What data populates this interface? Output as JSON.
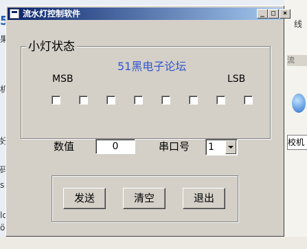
{
  "window": {
    "title": "流水灯控制软件",
    "minimize_glyph": "_",
    "maximize_glyph": "□",
    "close_glyph": "×"
  },
  "background": {
    "logo_fragment": "5",
    "right_fragment_top": "线",
    "right_bar_text": "流",
    "right_field_text": "校机",
    "left_fragments": [
      "果",
      "机",
      "好",
      "码",
      "s",
      "ld",
      "ö"
    ]
  },
  "led_group": {
    "legend": "小灯状态",
    "brand": "51黑电子论坛",
    "msb_label": "MSB",
    "lsb_label": "LSB",
    "leds": [
      {
        "bit": 7,
        "checked": false
      },
      {
        "bit": 6,
        "checked": false
      },
      {
        "bit": 5,
        "checked": false
      },
      {
        "bit": 4,
        "checked": false
      },
      {
        "bit": 3,
        "checked": false
      },
      {
        "bit": 2,
        "checked": false
      },
      {
        "bit": 1,
        "checked": false
      },
      {
        "bit": 0,
        "checked": false
      }
    ]
  },
  "value": {
    "label": "数值",
    "current": "0"
  },
  "port": {
    "label": "串口号",
    "selected": "1"
  },
  "buttons": {
    "send": "发送",
    "clear": "清空",
    "exit": "退出"
  },
  "colors": {
    "titlebar_start": "#0a246a",
    "titlebar_end": "#a6caf0",
    "face": "#d4d0c8",
    "brand_text": "#3355cc"
  }
}
